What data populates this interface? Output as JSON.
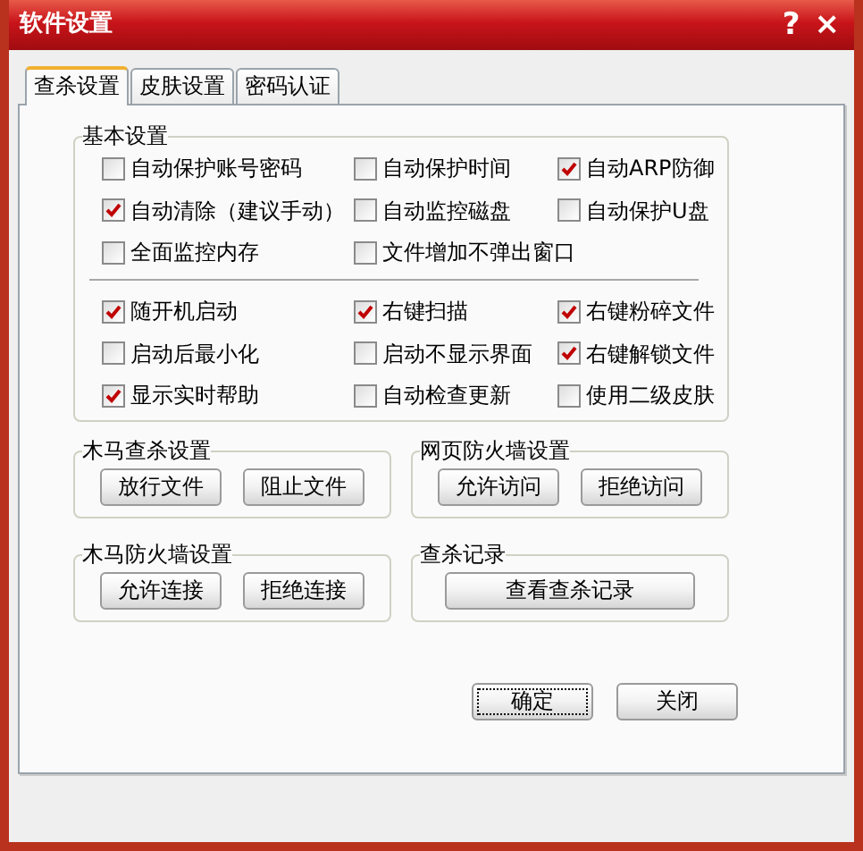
{
  "window": {
    "title": "软件设置",
    "help_button": "?",
    "close_button": "×"
  },
  "tabs": [
    {
      "label": "查杀设置",
      "selected": true
    },
    {
      "label": "皮肤设置",
      "selected": false
    },
    {
      "label": "密码认证",
      "selected": false
    }
  ],
  "basic_settings": {
    "title": "基本设置",
    "options": [
      {
        "label": "自动保护账号密码",
        "checked": false
      },
      {
        "label": "自动保护时间",
        "checked": false
      },
      {
        "label": "自动ARP防御",
        "checked": true
      },
      {
        "label": "自动清除（建议手动）",
        "checked": true
      },
      {
        "label": "自动监控磁盘",
        "checked": false
      },
      {
        "label": "自动保护U盘",
        "checked": false
      },
      {
        "label": "全面监控内存",
        "checked": false
      },
      {
        "label": "文件增加不弹出窗口",
        "checked": false
      }
    ],
    "options_2": [
      {
        "label": "随开机启动",
        "checked": true
      },
      {
        "label": "右键扫描",
        "checked": true
      },
      {
        "label": "右键粉碎文件",
        "checked": true
      },
      {
        "label": "启动后最小化",
        "checked": false
      },
      {
        "label": "启动不显示界面",
        "checked": false
      },
      {
        "label": "右键解锁文件",
        "checked": true
      },
      {
        "label": "显示实时帮助",
        "checked": true
      },
      {
        "label": "自动检查更新",
        "checked": false
      },
      {
        "label": "使用二级皮肤",
        "checked": false
      }
    ]
  },
  "groups": [
    {
      "title": "木马查杀设置",
      "buttons": [
        "放行文件",
        "阻止文件"
      ]
    },
    {
      "title": "网页防火墙设置",
      "buttons": [
        "允许访问",
        "拒绝访问"
      ]
    },
    {
      "title": "木马防火墙设置",
      "buttons": [
        "允许连接",
        "拒绝连接"
      ]
    },
    {
      "title": "查杀记录",
      "buttons": [
        "查看查杀记录"
      ]
    }
  ],
  "footer_buttons": [
    {
      "label": "确定",
      "focused": true
    },
    {
      "label": "关闭",
      "focused": false
    }
  ]
}
